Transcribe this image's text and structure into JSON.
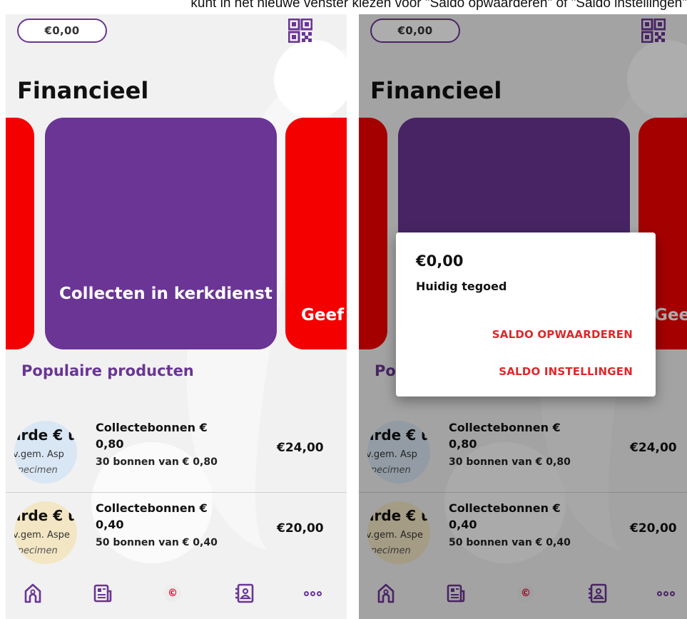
{
  "caption": "kunt in het nieuwe venster kiezen voor \"Saldo opwaarderen\" of \"Saldo instellingen\"",
  "header": {
    "balance": "€0,00"
  },
  "page": {
    "title": "Financieel"
  },
  "cards": {
    "main_label": "Collecten in kerkdienst",
    "right_label": "Geef"
  },
  "section": {
    "title": "Populaire producten"
  },
  "products": [
    {
      "name": "Collectebonnen € 0,80",
      "desc": "30 bonnen van € 0,80",
      "price": "€24,00",
      "thumb_text1": "arde € u",
      "thumb_text2": "v.gem. Asp",
      "thumb_text3": "specimen"
    },
    {
      "name": "Collectebonnen € 0,40",
      "desc": "50 bonnen van € 0,40",
      "price": "€20,00",
      "thumb_text1": "arde € u",
      "thumb_text2": "v.gem. Aspe",
      "thumb_text3": "specimen"
    }
  ],
  "nav": {
    "items": [
      "home-icon",
      "receipt-icon",
      "euro-icon",
      "contacts-icon",
      "more-icon"
    ],
    "euro_symbol": "©"
  },
  "dialog": {
    "amount": "€0,00",
    "subtitle": "Huidig tegoed",
    "action1": "SALDO OPWAARDEREN",
    "action2": "SALDO INSTELLINGEN"
  },
  "colors": {
    "brand_purple": "#6a3594",
    "brand_red": "#f40000",
    "action_red": "#e1262b"
  }
}
